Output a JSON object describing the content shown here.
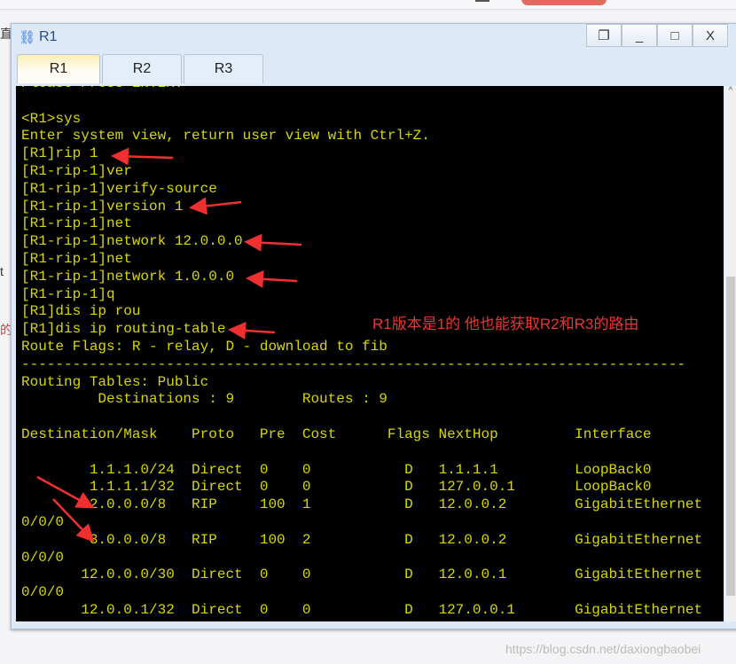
{
  "window": {
    "title": "R1",
    "controls": [
      "restore",
      "_",
      "□",
      "X"
    ]
  },
  "tabs": [
    {
      "label": "R1",
      "active": true
    },
    {
      "label": "R2"
    },
    {
      "label": "R3"
    }
  ],
  "terminal": {
    "lines": [
      "Please Press ENTER.",
      "",
      "<R1>sys",
      "Enter system view, return user view with Ctrl+Z.",
      "[R1]rip 1",
      "[R1-rip-1]ver",
      "[R1-rip-1]verify-source",
      "[R1-rip-1]version 1",
      "[R1-rip-1]net",
      "[R1-rip-1]network 12.0.0.0",
      "[R1-rip-1]net",
      "[R1-rip-1]network 1.0.0.0",
      "[R1-rip-1]q",
      "[R1]dis ip rou",
      "[R1]dis ip routing-table",
      "Route Flags: R - relay, D - download to fib",
      "------------------------------------------------------------------------------",
      "Routing Tables: Public",
      "         Destinations : 9        Routes : 9",
      "",
      "Destination/Mask    Proto   Pre  Cost      Flags NextHop         Interface",
      "",
      "        1.1.1.0/24  Direct  0    0           D   1.1.1.1         LoopBack0",
      "        1.1.1.1/32  Direct  0    0           D   127.0.0.1       LoopBack0",
      "        2.0.0.0/8   RIP     100  1           D   12.0.0.2        GigabitEthernet",
      "0/0/0",
      "        3.0.0.0/8   RIP     100  2           D   12.0.0.2        GigabitEthernet",
      "0/0/0",
      "       12.0.0.0/30  Direct  0    0           D   12.0.0.1        GigabitEthernet",
      "0/0/0",
      "       12.0.0.1/32  Direct  0    0           D   127.0.0.1       GigabitEthernet"
    ],
    "text_color": "#d8d800",
    "background": "#000000"
  },
  "annotation": {
    "text": "R1版本是1的 他也能获取R2和R3的路由",
    "color": "#ee3333"
  },
  "watermark": "https://blog.csdn.net/daxiongbaobei",
  "left_fragments": [
    "直",
    "t",
    "的",
    "t"
  ]
}
